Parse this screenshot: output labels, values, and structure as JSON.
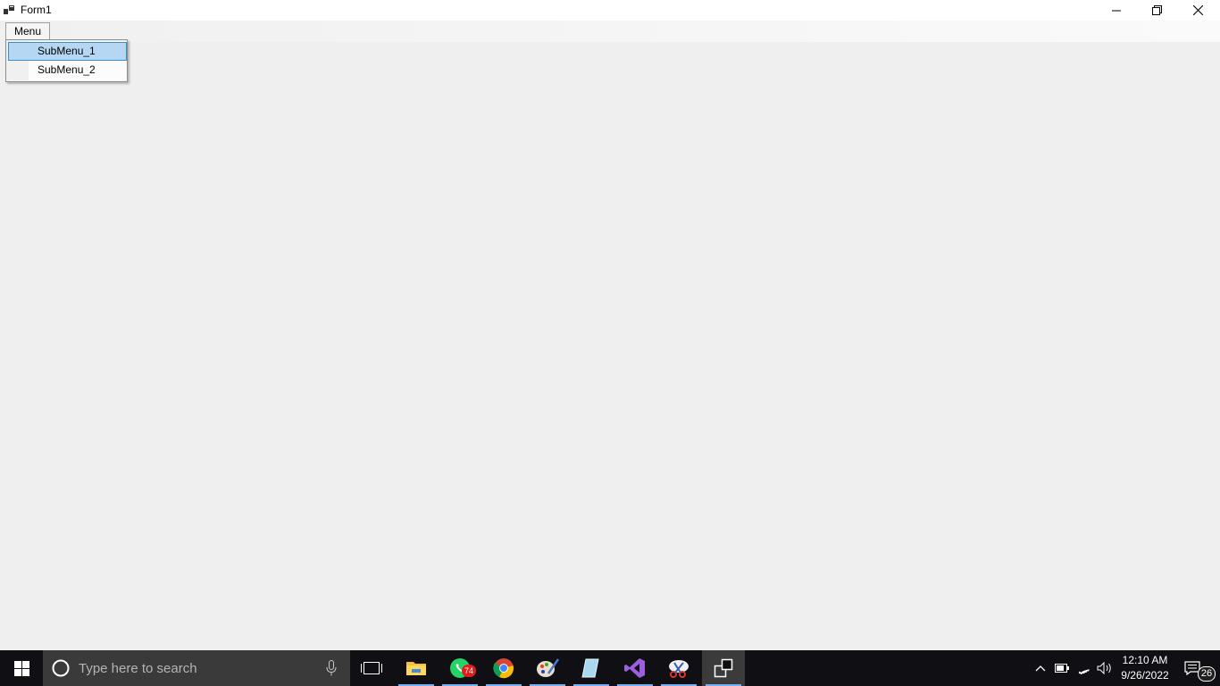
{
  "window": {
    "title": "Form1",
    "icon": "form-app-icon",
    "controls": [
      "minimize-icon",
      "restore-icon",
      "close-icon"
    ]
  },
  "menubar": {
    "items": [
      {
        "label": "Menu",
        "expanded": true
      }
    ]
  },
  "dropdown": {
    "items": [
      {
        "label": "SubMenu_1",
        "highlighted": true
      },
      {
        "label": "SubMenu_2",
        "highlighted": false
      }
    ]
  },
  "taskbar": {
    "search_placeholder": "Type here to search",
    "apps": [
      {
        "name": "task-view-icon",
        "running": false
      },
      {
        "name": "file-explorer-icon",
        "running": true
      },
      {
        "name": "whatsapp-icon",
        "running": true,
        "badge": "74"
      },
      {
        "name": "chrome-icon",
        "running": true
      },
      {
        "name": "paint-icon",
        "running": true
      },
      {
        "name": "notes-icon",
        "running": true
      },
      {
        "name": "visual-studio-icon",
        "running": true
      },
      {
        "name": "snipping-tool-icon",
        "running": true
      },
      {
        "name": "form-app-taskbar-icon",
        "running": true,
        "active": true
      }
    ],
    "tray": [
      "chevron-up-icon",
      "battery-icon",
      "wifi-icon",
      "volume-icon"
    ],
    "clock": {
      "time": "12:10 AM",
      "date": "9/26/2022"
    },
    "notifications": {
      "count": "26"
    }
  },
  "colors": {
    "menu_highlight": "#b5d7f3",
    "menu_highlight_border": "#3c8ed3",
    "client_background": "#efefef",
    "taskbar": "#0f0f14",
    "search_box": "#3a3a3a",
    "badge": "#e31c1c"
  }
}
